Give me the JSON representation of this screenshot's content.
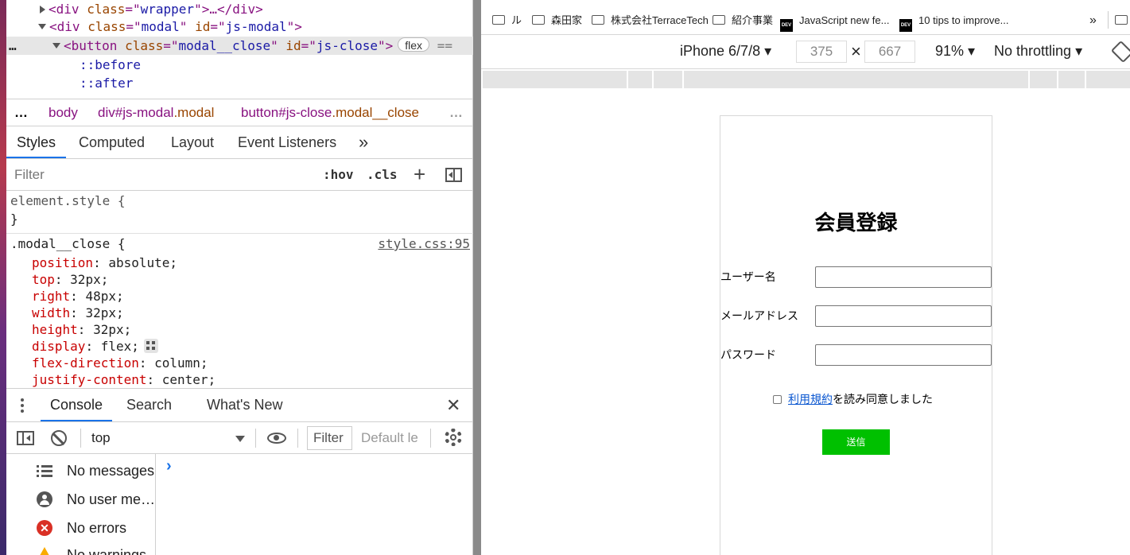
{
  "elements": {
    "line1": {
      "tag": "div",
      "attr": "class",
      "val": "wrapper",
      "rest": ">…</",
      "close": "div>"
    },
    "line2": {
      "tag": "div",
      "attr1": "class",
      "val1": "modal",
      "attr2": "id",
      "val2": "js-modal"
    },
    "line3": {
      "dots": "…",
      "tag": "button",
      "attr1": "class",
      "val1": "modal__close",
      "attr2": "id",
      "val2": "js-close",
      "badge": "flex",
      "eq": "=="
    },
    "before": "::before",
    "after": "::after"
  },
  "breadcrumb": {
    "dots": "…",
    "body": "body",
    "modal_tag": "div",
    "modal_rest": "#js-modal",
    "modal_cls": ".modal",
    "btn_tag": "button",
    "btn_rest": "#js-close",
    "btn_cls": ".modal__close",
    "more": "…"
  },
  "tabs": {
    "styles": "Styles",
    "computed": "Computed",
    "layout": "Layout",
    "event_listeners": "Event Listeners",
    "more": "»"
  },
  "filter": {
    "placeholder": "Filter",
    "hov": ":hov",
    "cls": ".cls",
    "add": "+"
  },
  "styles": {
    "element_style": "element.style {",
    "close_brace": "}",
    "selector": ".modal__close {",
    "source": "style.css:95",
    "props": [
      {
        "name": "position",
        "value": "absolute;"
      },
      {
        "name": "top",
        "value": "32px;"
      },
      {
        "name": "right",
        "value": "48px;"
      },
      {
        "name": "width",
        "value": "32px;"
      },
      {
        "name": "height",
        "value": "32px;"
      },
      {
        "name": "display",
        "value": "flex;"
      },
      {
        "name": "flex-direction",
        "value": "column;"
      },
      {
        "name": "justify-content",
        "value": "center;"
      }
    ]
  },
  "drawer": {
    "tabs": {
      "console": "Console",
      "search": "Search",
      "whats_new": "What's New"
    },
    "close": "✕",
    "context": "top",
    "filter_placeholder": "Filter",
    "levels": "Default le",
    "prompt": "›",
    "sidebar": [
      {
        "label": "No messages"
      },
      {
        "label": "No user me…"
      },
      {
        "label": "No errors"
      },
      {
        "label": "No warnings"
      }
    ]
  },
  "bookmarks": [
    {
      "label": "ル",
      "icon": "folder-icon"
    },
    {
      "label": "森田家",
      "icon": "folder-icon"
    },
    {
      "label": "株式会社TerraceTech",
      "icon": "folder-icon"
    },
    {
      "label": "紹介事業",
      "icon": "folder-icon"
    },
    {
      "label": "JavaScript new fe...",
      "icon": "dev-icon"
    },
    {
      "label": "10 tips to improve...",
      "icon": "dev-icon"
    }
  ],
  "bookmarks_more": "»",
  "device": {
    "name": "iPhone 6/7/8",
    "width": "375",
    "x": "×",
    "height": "667",
    "zoom": "91%",
    "throttle": "No throttling"
  },
  "page": {
    "title": "会員登録",
    "fields": [
      {
        "label": "ユーザー名"
      },
      {
        "label": "メールアドレス"
      },
      {
        "label": "パスワード"
      }
    ],
    "terms_link": "利用規約",
    "terms_text": "を読み同意しました",
    "submit": "送信"
  }
}
